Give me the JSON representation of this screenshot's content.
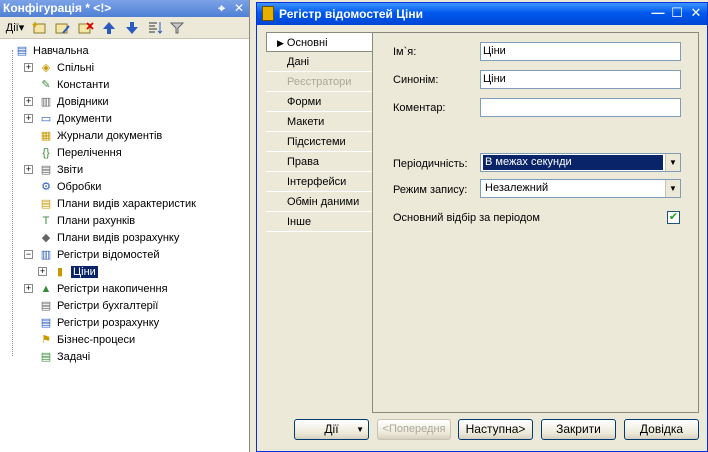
{
  "left_panel": {
    "title": "Конфігурація * <!>",
    "pin_icon": "⌖",
    "close_icon": "✕",
    "toolbar": {
      "actions_label": "Дії",
      "actions_arrow": "▾"
    },
    "tree": [
      {
        "label": "Навчальна",
        "icon": "config-root-icon",
        "glyph": "▤",
        "level": 0,
        "expander": ""
      },
      {
        "label": "Спільні",
        "icon": "common-icon",
        "glyph": "◈",
        "level": 1,
        "expander": "+"
      },
      {
        "label": "Константи",
        "icon": "constants-icon",
        "glyph": "✎",
        "level": 1,
        "expander": ""
      },
      {
        "label": "Довідники",
        "icon": "catalogs-icon",
        "glyph": "▥",
        "level": 1,
        "expander": "+"
      },
      {
        "label": "Документи",
        "icon": "documents-icon",
        "glyph": "▭",
        "level": 1,
        "expander": "+"
      },
      {
        "label": "Журнали документів",
        "icon": "journals-icon",
        "glyph": "▦",
        "level": 1,
        "expander": ""
      },
      {
        "label": "Перелічення",
        "icon": "enums-icon",
        "glyph": "{}",
        "level": 1,
        "expander": ""
      },
      {
        "label": "Звіти",
        "icon": "reports-icon",
        "glyph": "▤",
        "level": 1,
        "expander": "+"
      },
      {
        "label": "Обробки",
        "icon": "processors-icon",
        "glyph": "⚙",
        "level": 1,
        "expander": ""
      },
      {
        "label": "Плани видів характеристик",
        "icon": "char-plans-icon",
        "glyph": "▤",
        "level": 1,
        "expander": ""
      },
      {
        "label": "Плани рахунків",
        "icon": "accounts-plans-icon",
        "glyph": "T",
        "level": 1,
        "expander": ""
      },
      {
        "label": "Плани видів розрахунку",
        "icon": "calc-plans-icon",
        "glyph": "◆",
        "level": 1,
        "expander": ""
      },
      {
        "label": "Регістри відомостей",
        "icon": "info-registers-icon",
        "glyph": "▥",
        "level": 1,
        "expander": "−"
      },
      {
        "label": "Ціни",
        "icon": "register-item-icon",
        "glyph": "▮",
        "level": 2,
        "expander": "+",
        "selected": true
      },
      {
        "label": "Регістри накопичення",
        "icon": "accum-registers-icon",
        "glyph": "▲",
        "level": 1,
        "expander": "+"
      },
      {
        "label": "Регістри бухгалтерії",
        "icon": "acct-registers-icon",
        "glyph": "▤",
        "level": 1,
        "expander": ""
      },
      {
        "label": "Регістри розрахунку",
        "icon": "calc-registers-icon",
        "glyph": "▤",
        "level": 1,
        "expander": ""
      },
      {
        "label": "Бізнес-процеси",
        "icon": "business-process-icon",
        "glyph": "⚑",
        "level": 1,
        "expander": ""
      },
      {
        "label": "Задачі",
        "icon": "tasks-icon",
        "glyph": "▤",
        "level": 1,
        "expander": ""
      }
    ]
  },
  "dialog": {
    "title": "Регістр відомостей Ціни",
    "min_icon": "—",
    "max_icon": "☐",
    "close_icon": "✕",
    "tabs": [
      {
        "label": "Основні",
        "active": true,
        "disabled": false,
        "marker": "▶"
      },
      {
        "label": "Дані",
        "active": false,
        "disabled": false
      },
      {
        "label": "Реєстратори",
        "active": false,
        "disabled": true
      },
      {
        "label": "Форми",
        "active": false,
        "disabled": false
      },
      {
        "label": "Макети",
        "active": false,
        "disabled": false
      },
      {
        "label": "Підсистеми",
        "active": false,
        "disabled": false
      },
      {
        "label": "Права",
        "active": false,
        "disabled": false
      },
      {
        "label": "Інтерфейси",
        "active": false,
        "disabled": false
      },
      {
        "label": "Обмін даними",
        "active": false,
        "disabled": false
      },
      {
        "label": "Інше",
        "active": false,
        "disabled": false
      }
    ],
    "form": {
      "name_label": "Ім`я:",
      "name_value": "Ціни",
      "synonym_label": "Синонім:",
      "synonym_value": "Ціни",
      "comment_label": "Коментар:",
      "comment_value": "",
      "periodicity_label": "Періодичність:",
      "periodicity_value": "В межах секунди",
      "write_mode_label": "Режим запису:",
      "write_mode_value": "Незалежний",
      "main_filter_label": "Основний відбір за періодом",
      "main_filter_checked": "✔",
      "combo_arrow": "▼"
    },
    "buttons": {
      "actions": "Дії",
      "actions_arrow": "▼",
      "previous": "<Попередня",
      "next": "Наступна>",
      "close": "Закрити",
      "help": "Довідка"
    }
  }
}
